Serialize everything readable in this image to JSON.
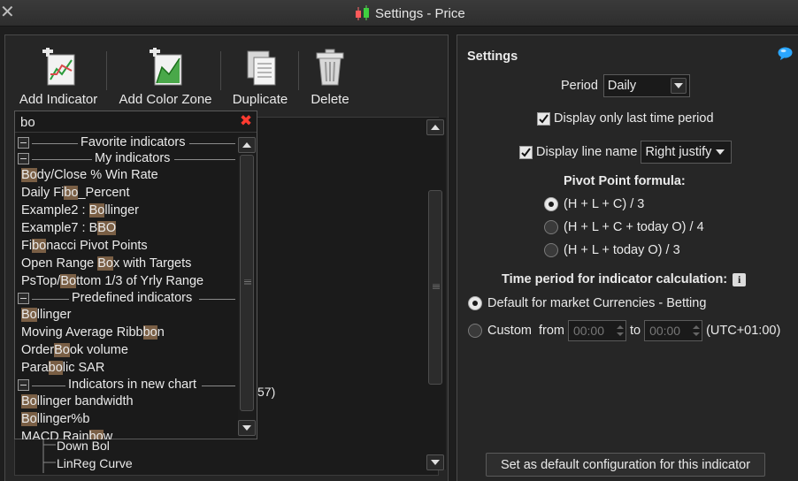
{
  "window": {
    "title": "Settings - Price"
  },
  "toolbar": {
    "add_indicator": "Add Indicator",
    "add_color_zone": "Add Color Zone",
    "duplicate": "Duplicate",
    "delete": "Delete"
  },
  "search": {
    "query": "bo"
  },
  "groups": {
    "favorite": "Favorite indicators",
    "my": "My indicators",
    "predefined": "Predefined indicators",
    "new_chart": "Indicators in new chart"
  },
  "my_indicators": [
    {
      "pre": "",
      "hl": "Bo",
      "post": "dy/Close % Win Rate"
    },
    {
      "pre": "Daily Fi",
      "hl": "bo",
      "post": "_Percent"
    },
    {
      "pre": "Example2 : ",
      "hl": "Bo",
      "post": "llinger"
    },
    {
      "pre": "Example7 : B",
      "hl": "BO",
      "post": ""
    },
    {
      "pre": "Fi",
      "hl": "bo",
      "post": "nacci Pivot Points"
    },
    {
      "pre": "Open Range ",
      "hl": "Bo",
      "post": "x with Targets"
    },
    {
      "pre": "PsTop/",
      "hl": "Bo",
      "post": "ttom 1/3 of Yrly Range"
    }
  ],
  "predefined_indicators": [
    {
      "pre": "",
      "hl": "Bo",
      "post": "llinger"
    },
    {
      "pre": "Moving Average Ribb",
      "hl": "bo",
      "post": "n"
    },
    {
      "pre": "Order",
      "hl": "Bo",
      "post": "ok volume"
    },
    {
      "pre": "Para",
      "hl": "bo",
      "post": "lic SAR"
    }
  ],
  "new_chart_indicators": [
    {
      "pre": "",
      "hl": "Bo",
      "post": "llinger bandwidth"
    },
    {
      "pre": "",
      "hl": "Bo",
      "post": "llinger%b"
    },
    {
      "pre": "MACD Rain",
      "hl": "bo",
      "post": "w"
    }
  ],
  "tree": {
    "partial_value": "57)",
    "item_down_bol": "Down Bol",
    "item_linreg": "LinReg Curve"
  },
  "settings": {
    "title": "Settings",
    "period_label": "Period",
    "period_value": "Daily",
    "last_period_label": "Display only last time period",
    "last_period_checked": true,
    "line_name_label": "Display line name",
    "line_name_checked": true,
    "justify_value": "Right justify",
    "pivot_heading": "Pivot Point formula:",
    "pivot_options": [
      {
        "label": "(H + L + C) / 3",
        "selected": true
      },
      {
        "label": "(H + L + C + today O) / 4",
        "selected": false
      },
      {
        "label": "(H + L + today O) / 3",
        "selected": false
      }
    ],
    "time_heading": "Time period for indicator calculation:",
    "default_option": "Default for market Currencies - Betting",
    "custom_option": "Custom",
    "from_label": "from",
    "from_value": "00:00",
    "to_label": "to",
    "to_value": "00:00",
    "timezone": "(UTC+01:00)",
    "default_button": "Set as default configuration for this indicator"
  },
  "colors": {
    "highlight": "#7a5f45",
    "close_red": "#ff3b30",
    "help_blue": "#2aa6ff"
  }
}
